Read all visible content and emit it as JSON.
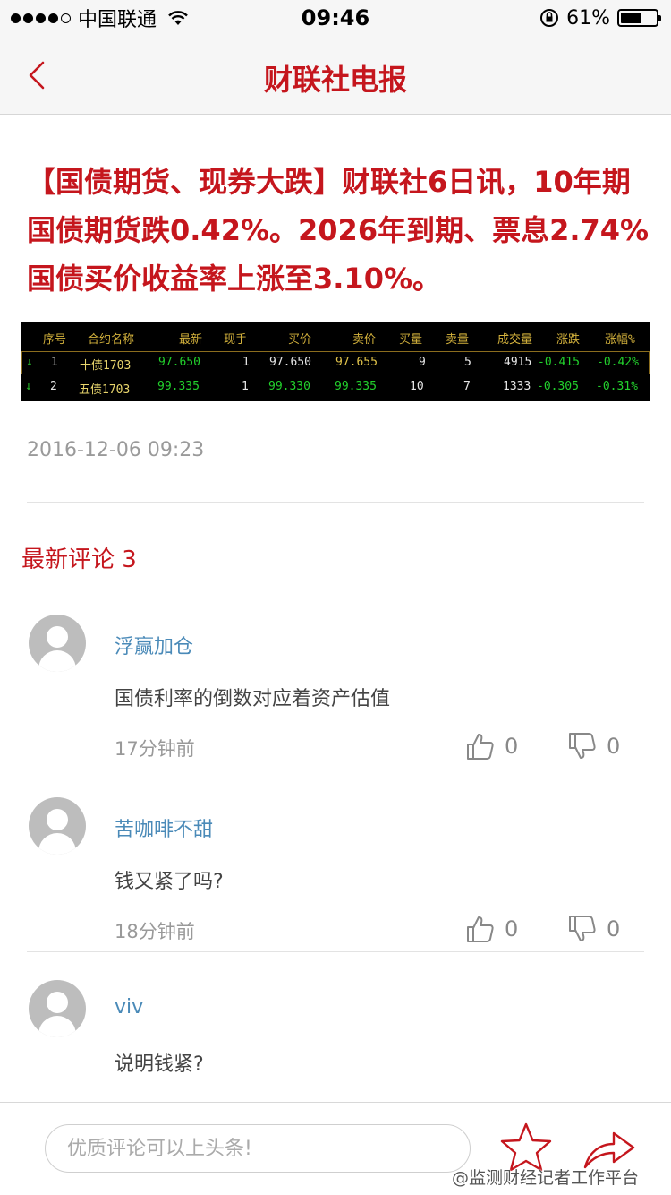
{
  "status_bar": {
    "carrier": "中国联通",
    "time": "09:46",
    "battery_percent": "61%",
    "battery_level": 0.61
  },
  "nav": {
    "title": "财联社电报"
  },
  "article": {
    "headline": "【国债期货、现券大跌】财联社6日讯，10年期国债期货跌0.42%。2026年到期、票息2.74%国债买价收益率上涨至3.10%。",
    "timestamp": "2016-12-06 09:23",
    "quote_table": {
      "columns": [
        "序号",
        "合约名称",
        "最新",
        "现手",
        "买价",
        "卖价",
        "买量",
        "卖量",
        "成交量",
        "涨跌",
        "涨幅%"
      ],
      "rows": [
        [
          "1",
          "十债1703",
          "97.650",
          "1",
          "97.650",
          "97.655",
          "9",
          "5",
          "4915",
          "-0.415",
          "-0.42%"
        ],
        [
          "2",
          "五债1703",
          "99.335",
          "1",
          "99.330",
          "99.335",
          "10",
          "7",
          "1333",
          "-0.305",
          "-0.31%"
        ]
      ]
    }
  },
  "comments": {
    "title": "最新评论 3",
    "items": [
      {
        "user": "浮赢加仓",
        "text": "国债利率的倒数对应着资产估值",
        "time": "17分钟前",
        "likes": "0",
        "dislikes": "0"
      },
      {
        "user": "苦咖啡不甜",
        "text": "钱又紧了吗?",
        "time": "18分钟前",
        "likes": "0",
        "dislikes": "0"
      },
      {
        "user": "viv",
        "text": "说明钱紧?",
        "time": "",
        "likes": "",
        "dislikes": ""
      }
    ]
  },
  "bottom": {
    "input_placeholder": "优质评论可以上头条!",
    "watermark": "@监测财经记者工作平台"
  },
  "colors": {
    "accent": "#c5161d",
    "username": "#4a8ab8"
  }
}
